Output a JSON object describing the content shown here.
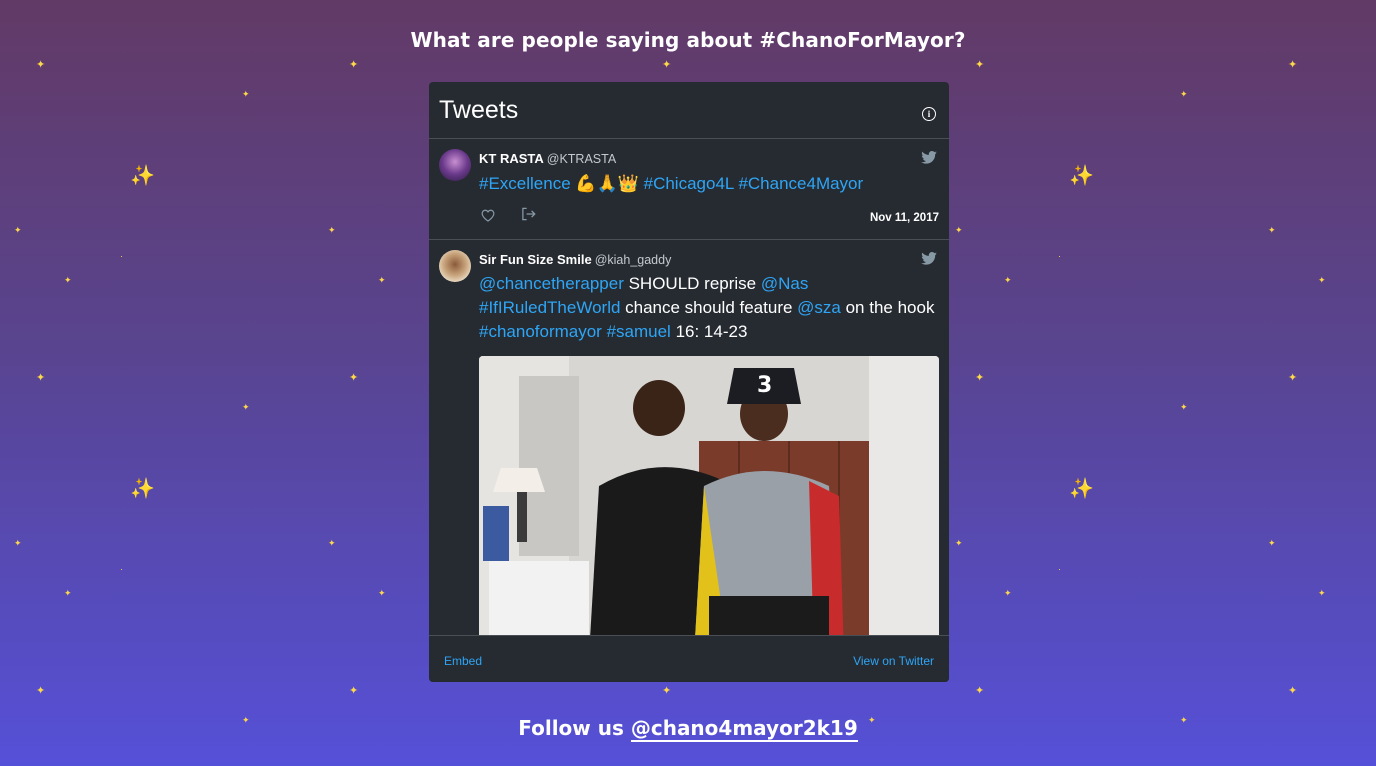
{
  "heading": "What are people saying about #ChanoForMayor?",
  "widget": {
    "title": "Tweets",
    "info_icon": "info-icon",
    "tweets": [
      {
        "name": "KT RASTA",
        "handle": "@KTRASTA",
        "text_parts": [
          "#Excellence 💪🙏👑 #Chicago4L #Chance4Mayor"
        ],
        "date": "Nov 11, 2017",
        "icons": [
          "heart-icon",
          "share-icon",
          "twitter-bird-icon"
        ]
      },
      {
        "name": "Sir Fun Size Smile",
        "handle": "@kiah_gaddy",
        "t1": "@chancetherapper",
        "t2": " SHOULD reprise ",
        "t3": "@Nas",
        "t4": "#IfIRuledTheWorld",
        "t5": " chance should feature  ",
        "t6": "@sza",
        "t7": " on the hook  ",
        "t8": "#chanoformayor",
        "t9": " ",
        "t10": "#samuel",
        "t11": " 16: 14-23",
        "media": "photo"
      }
    ],
    "footer": {
      "embed": "Embed",
      "view": "View on Twitter"
    }
  },
  "follow": {
    "prefix": "Follow us ",
    "handle": "@chano4mayor2k19"
  },
  "colors": {
    "link": "#2ea5f5",
    "widget_bg": "#262b32",
    "sparkle": "#ffd84a"
  }
}
